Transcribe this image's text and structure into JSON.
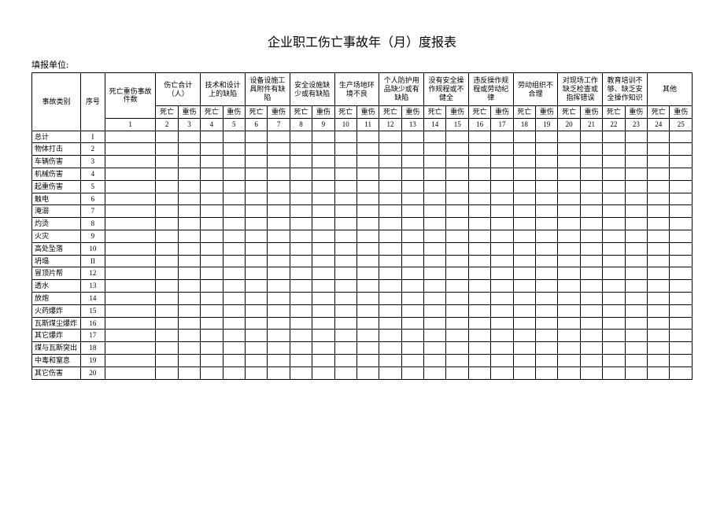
{
  "title": "企业职工伤亡事故年（月）度报表",
  "unit_label": "填报单位:",
  "headers": {
    "cat": "事故类别",
    "seq": "序号",
    "count": "死亡重伤事故件数",
    "groups": [
      "伤亡合计（人）",
      "技术和设计上的缺陷",
      "设备设施工具附件有缺陷",
      "安全设施缺少或有缺陷",
      "生产场地环境不良",
      "个人防护用品缺少或有缺陷",
      "没有安全操作规程或不健全",
      "违反操作规程或劳动纪律",
      "劳动组织不合理",
      "对现场工作缺乏检查或指挥错误",
      "教育培训不够、缺乏安全操作知识",
      "其他"
    ],
    "death": "死亡",
    "injury": "重伤"
  },
  "col_nums": [
    "1",
    "2",
    "3",
    "4",
    "5",
    "6",
    "7",
    "8",
    "9",
    "10",
    "11",
    "12",
    "13",
    "14",
    "15",
    "16",
    "17",
    "18",
    "19",
    "20",
    "21",
    "22",
    "23",
    "24",
    "25"
  ],
  "rows": [
    {
      "cat": "总计",
      "seq": "I"
    },
    {
      "cat": "物体打击",
      "seq": "2"
    },
    {
      "cat": "车辆伤害",
      "seq": "3"
    },
    {
      "cat": "机械伤害",
      "seq": "4"
    },
    {
      "cat": "起重伤害",
      "seq": "5"
    },
    {
      "cat": "触电",
      "seq": "6"
    },
    {
      "cat": "淹溺",
      "seq": "7"
    },
    {
      "cat": "灼烫",
      "seq": "8"
    },
    {
      "cat": "火灾",
      "seq": "9"
    },
    {
      "cat": "高处坠落",
      "seq": "10"
    },
    {
      "cat": "坍塌",
      "seq": "II"
    },
    {
      "cat": "冒顶片帮",
      "seq": "12"
    },
    {
      "cat": "透水",
      "seq": "13"
    },
    {
      "cat": "放炮",
      "seq": "14"
    },
    {
      "cat": "火药爆炸",
      "seq": "15"
    },
    {
      "cat": "瓦斯煤尘爆炸",
      "seq": "16"
    },
    {
      "cat": "其它爆炸",
      "seq": "17"
    },
    {
      "cat": "煤与瓦斯突出",
      "seq": "18"
    },
    {
      "cat": "中毒和窒息",
      "seq": "19"
    },
    {
      "cat": "其它伤害",
      "seq": "20"
    }
  ]
}
